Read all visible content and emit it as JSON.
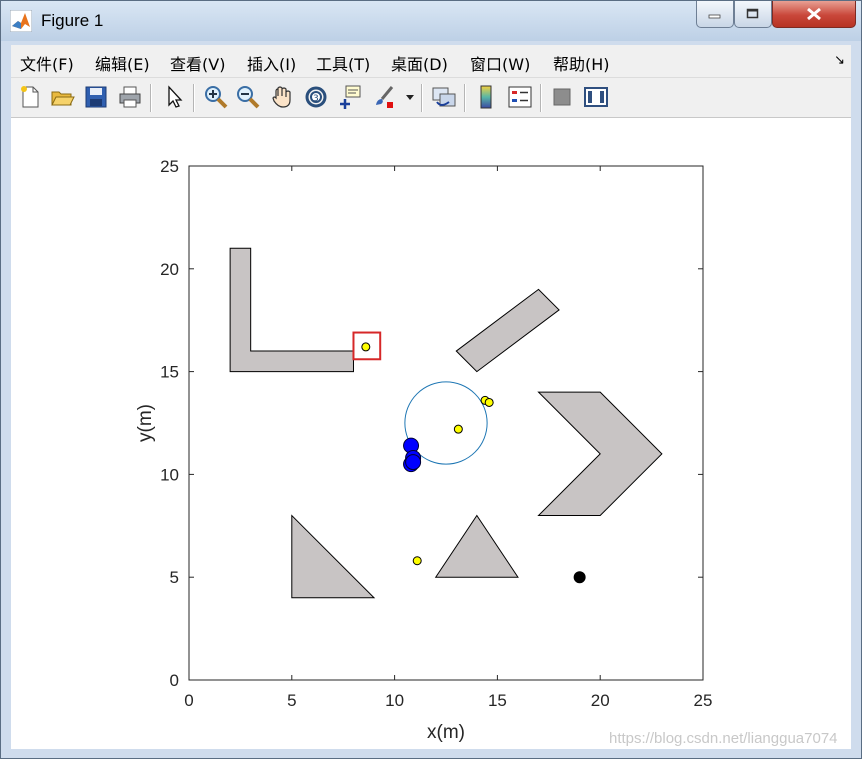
{
  "window": {
    "title": "Figure 1"
  },
  "menu": {
    "items": [
      {
        "label": "文件(F)"
      },
      {
        "label": "编辑(E)"
      },
      {
        "label": "查看(V)"
      },
      {
        "label": "插入(I)"
      },
      {
        "label": "工具(T)"
      },
      {
        "label": "桌面(D)"
      },
      {
        "label": "窗口(W)"
      },
      {
        "label": "帮助(H)"
      }
    ],
    "dock_glyph": "↘"
  },
  "toolbar": {
    "buttons": [
      "new-figure-icon",
      "open-file-icon",
      "save-icon",
      "print-icon",
      "pointer-icon",
      "zoom-in-icon",
      "zoom-out-icon",
      "pan-hand-icon",
      "rotate-3d-icon",
      "data-cursor-icon",
      "brush-icon",
      "link-plot-icon",
      "colorbar-icon",
      "legend-icon",
      "hide-plot-tools-icon",
      "show-plot-tools-icon"
    ]
  },
  "chart_data": {
    "type": "scatter",
    "xlabel": "x(m)",
    "ylabel": "y(m)",
    "xlim": [
      0,
      25
    ],
    "ylim": [
      0,
      25
    ],
    "xticks": [
      "0",
      "5",
      "10",
      "15",
      "20",
      "25"
    ],
    "yticks": [
      "0",
      "5",
      "10",
      "15",
      "20",
      "25"
    ],
    "obstacle_color": "#c8c4c4",
    "obstacles": [
      {
        "points": [
          [
            2,
            21
          ],
          [
            3,
            21
          ],
          [
            3,
            16
          ],
          [
            8,
            16
          ],
          [
            8,
            15
          ],
          [
            2,
            15
          ]
        ]
      },
      {
        "points": [
          [
            13,
            16
          ],
          [
            17,
            19
          ],
          [
            18,
            18
          ],
          [
            14,
            15
          ]
        ]
      },
      {
        "points": [
          [
            17,
            14
          ],
          [
            20,
            14
          ],
          [
            23,
            11
          ],
          [
            20,
            8
          ],
          [
            17,
            8
          ],
          [
            20,
            11
          ]
        ]
      },
      {
        "points": [
          [
            5,
            8
          ],
          [
            5,
            4
          ],
          [
            9,
            4
          ]
        ]
      },
      {
        "points": [
          [
            12,
            5
          ],
          [
            16,
            5
          ],
          [
            14,
            8
          ]
        ]
      }
    ],
    "circle": {
      "cx": 12.5,
      "cy": 12.5,
      "r": 2.0,
      "color": "#1f77b4"
    },
    "highlight_box": {
      "x0": 8.0,
      "y0": 15.6,
      "x1": 9.3,
      "y1": 16.9,
      "color": "#d62728"
    },
    "yellow_points": [
      [
        8.6,
        16.2
      ],
      [
        13.1,
        12.2
      ],
      [
        14.4,
        13.6
      ],
      [
        14.6,
        13.5
      ],
      [
        11.1,
        5.8
      ]
    ],
    "blue_points": [
      [
        10.8,
        11.4
      ],
      [
        10.9,
        10.8
      ],
      [
        10.8,
        10.5
      ],
      [
        10.9,
        10.6
      ]
    ],
    "black_points": [
      [
        19.0,
        5.0
      ]
    ]
  },
  "watermark": {
    "text": "https://blog.csdn.net/lianggua7074"
  }
}
